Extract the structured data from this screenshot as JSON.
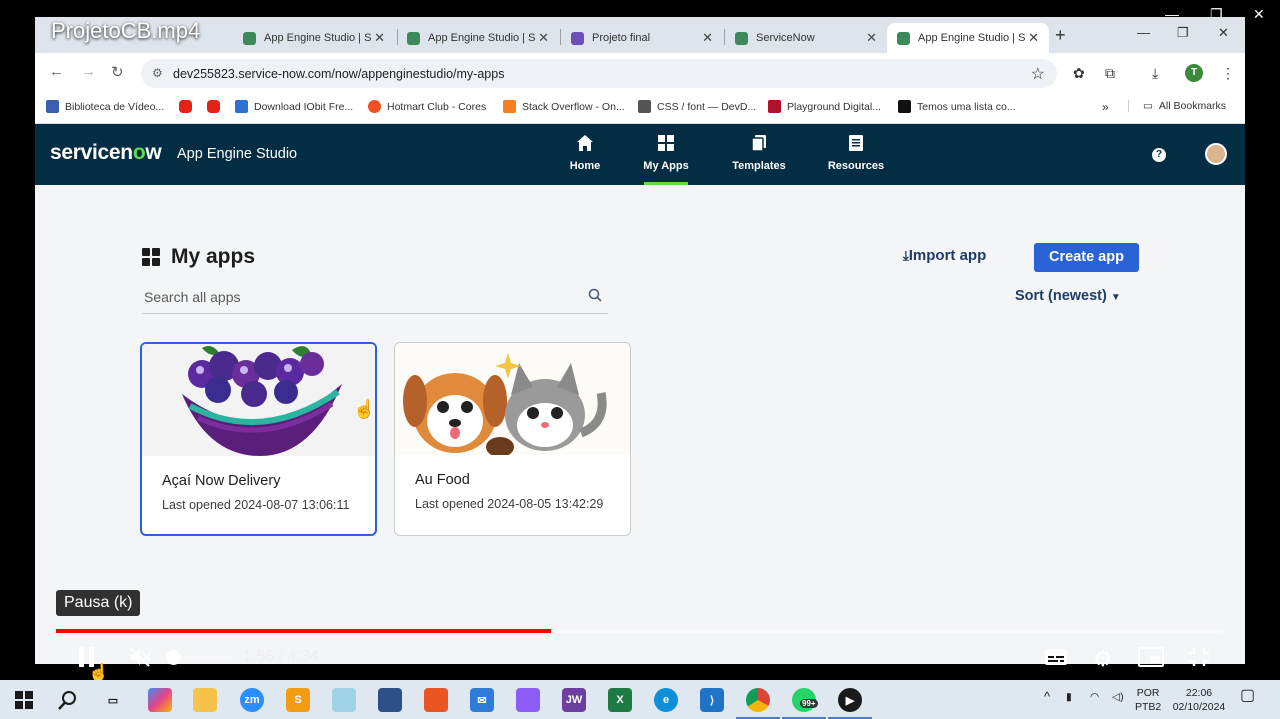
{
  "video_title": "ProjetoCB.mp4",
  "browser": {
    "tabs": [
      {
        "title": "App Engine Studio | S",
        "color": "#3c8a5a"
      },
      {
        "title": "App Engine Studio | S",
        "color": "#3c8a5a"
      },
      {
        "title": "Projeto final",
        "color": "#6b4fbb"
      },
      {
        "title": "ServiceNow",
        "color": "#3c8a5a"
      },
      {
        "title": "App Engine Studio | S",
        "color": "#3c8a5a"
      }
    ],
    "close_glyph": "✕",
    "new_tab_glyph": "+",
    "url": "dev255823.service-now.com/now/appenginestudio/my-apps",
    "bookmarks": [
      {
        "label": "Biblioteca de Vídeo...",
        "color": "#3a5fb0"
      },
      {
        "label": "",
        "color": "#e62117"
      },
      {
        "label": "",
        "color": "#e62117"
      },
      {
        "label": "Download IObit Fre...",
        "color": "#2f6fd0"
      },
      {
        "label": "Hotmart Club - Cores",
        "color": "#f04e23"
      },
      {
        "label": "Stack Overflow - On...",
        "color": "#f48024"
      },
      {
        "label": "CSS / font — DevD...",
        "color": "#555555"
      },
      {
        "label": "Playground Digital...",
        "color": "#b0102a"
      },
      {
        "label": "Temos uma lista co...",
        "color": "#111111"
      }
    ],
    "all_bookmarks": "All Bookmarks",
    "profile_initial": "T"
  },
  "servicenow": {
    "logo_text_a": "servicen",
    "logo_text_o": "o",
    "logo_text_b": "w",
    "app_name": "App Engine Studio",
    "nav": [
      {
        "label": "Home",
        "icon": "home-icon"
      },
      {
        "label": "My Apps",
        "icon": "grid-icon"
      },
      {
        "label": "Templates",
        "icon": "templates-icon"
      },
      {
        "label": "Resources",
        "icon": "resources-icon"
      }
    ],
    "help_glyph": "?"
  },
  "page": {
    "title": "My apps",
    "search_placeholder": "Search all apps",
    "import_label": "Import app",
    "create_label": "Create app",
    "sort_label": "Sort (newest)",
    "apps": [
      {
        "name": "Açaí Now Delivery",
        "last_opened": "Last opened 2024-08-07 13:06:11"
      },
      {
        "name": "Au Food",
        "last_opened": "Last opened 2024-08-05 13:42:29"
      }
    ]
  },
  "player": {
    "tooltip": "Pausa (k)",
    "time": "1:56 / 4:34",
    "progress": 0.424,
    "volume": 0
  },
  "taskbar": {
    "lang_a": "POR",
    "lang_b": "PTB2",
    "clock_time": "22:06",
    "clock_date": "02/10/2024",
    "notif_badge": "99+"
  }
}
